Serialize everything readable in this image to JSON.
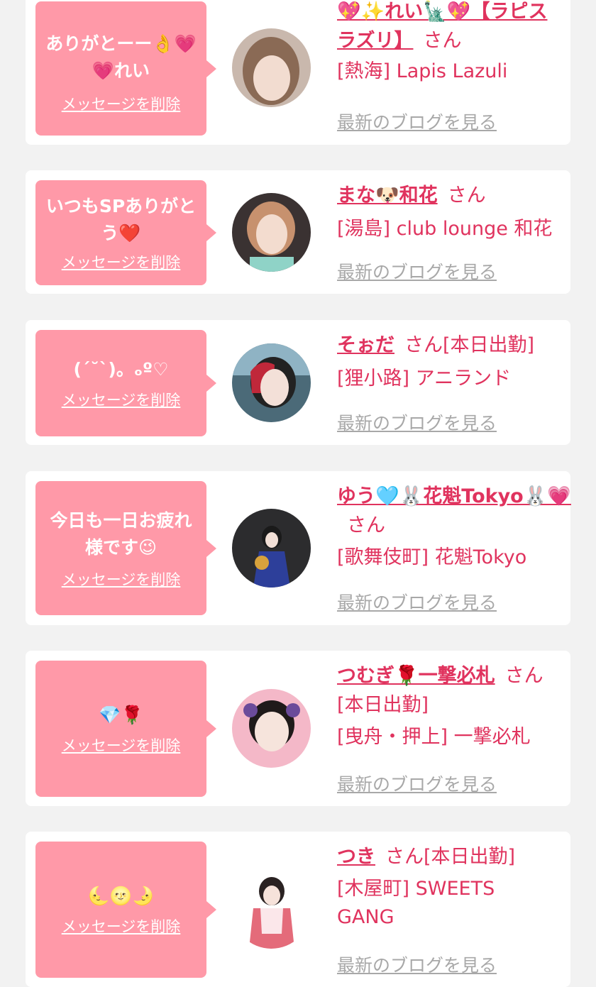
{
  "delete_label": "メッセージを削除",
  "blog_label": "最新のブログを見る",
  "cards": [
    {
      "message": "ありがとーー👌💗💗れい",
      "name": "💖✨れい🗽💖【ラピスラズリ】",
      "suffix": "さん",
      "status": "",
      "shop": "[熱海] Lapis Lazuli"
    },
    {
      "message": "いつもSPありがとう❤️",
      "name": "まな🐶和花",
      "suffix": "さん",
      "status": "",
      "shop": "[湯島] club lounge 和花"
    },
    {
      "message": "(ˊ˘ˋ)。ₒº♡",
      "name": "そぉだ",
      "suffix": "さん",
      "status": "[本日出勤]",
      "shop": "[狸小路] アニランド"
    },
    {
      "message": "今日も一日お疲れ様です😉",
      "name": "ゆう🩵🐰花魁Tokyo🐰💗",
      "suffix": "さん",
      "status": "",
      "shop": "[歌舞伎町] 花魁Tokyo"
    },
    {
      "message": "💎🌹",
      "name": "つむぎ🌹一撃必札",
      "suffix": "さん",
      "status": "[本日出勤]",
      "shop": "[曳舟・押上] 一撃必札"
    },
    {
      "message": "🌜🌝🌛",
      "name": "つき",
      "suffix": "さん",
      "status": "[本日出勤]",
      "shop": "[木屋町] SWEETS GANG"
    }
  ]
}
